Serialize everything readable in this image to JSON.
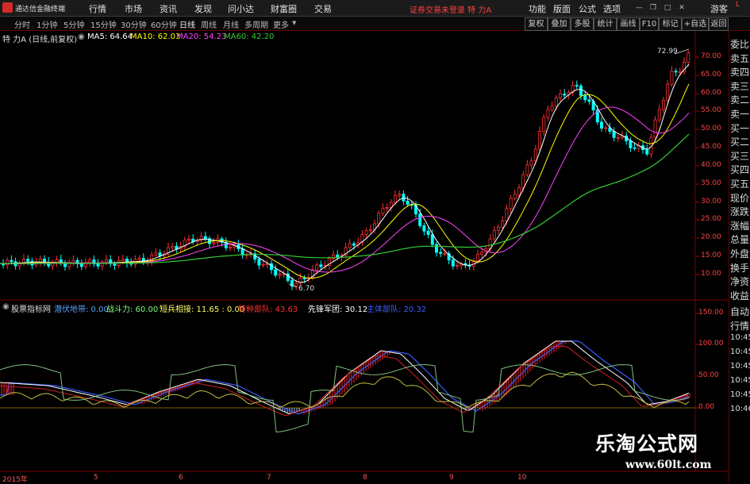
{
  "titlebar": {
    "app_name": "通达信金融终端",
    "menu": [
      "行情",
      "市场",
      "资讯",
      "发现",
      "问小达",
      "财富圈",
      "交易"
    ],
    "status": "证券交易未登录  特 力A",
    "right_menu": [
      "功能",
      "版面",
      "公式",
      "选项"
    ],
    "right_extra": "游客"
  },
  "periods": [
    "分时",
    "1分钟",
    "5分钟",
    "15分钟",
    "30分钟",
    "60分钟",
    "日线",
    "周线",
    "月线",
    "多周期",
    "更多"
  ],
  "active_period": "日线",
  "tools": [
    "复权",
    "叠加",
    "多股",
    "统计",
    "画线",
    "F10",
    "标记",
    "+自选",
    "返回"
  ],
  "main_chart": {
    "title": "特 力A (日线,前复权)",
    "ma": [
      {
        "label": "MA5: 64.64",
        "color": "#ffffff"
      },
      {
        "label": "MA10: 62.03",
        "color": "#ffff00"
      },
      {
        "label": "MA20: 54.23",
        "color": "#ff44ff"
      },
      {
        "label": "MA60: 42.20",
        "color": "#33cc33"
      }
    ],
    "high_label": "72.99",
    "low_label": "6.70",
    "y_ticks": [
      "70.00",
      "65.00",
      "60.00",
      "55.00",
      "50.00",
      "45.00",
      "40.00",
      "35.00",
      "30.00",
      "25.00",
      "20.00",
      "15.00",
      "10.00"
    ]
  },
  "indicator": {
    "name": "股票指标网",
    "items": [
      {
        "label": "潜伏地带: 0.00",
        "color": "#5aa0ff"
      },
      {
        "label": "战斗力: 60.00",
        "color": "#7fff7f"
      },
      {
        "label": "短兵相接: 11.65 : 0.00",
        "color": "#ffff66"
      },
      {
        "label": "特种部队: 43.63",
        "color": "#ff3030"
      },
      {
        "label": "先锋军团: 30.12",
        "color": "#ffffff"
      },
      {
        "label": "主体部队: 20.32",
        "color": "#3a5cff"
      }
    ],
    "y_ticks": [
      "150.00",
      "100.00",
      "50.00",
      "0.00"
    ]
  },
  "side_panel": [
    "委比",
    "卖五",
    "卖四",
    "卖三",
    "卖二",
    "卖一",
    "买一",
    "买二",
    "买三",
    "买四",
    "买五",
    "现价",
    "涨跌",
    "涨幅",
    "总量",
    "外盘",
    "换手",
    "净资",
    "收益"
  ],
  "side_panel_lower": [
    "自动",
    "行情",
    "10:45",
    "10:45",
    "10:45",
    "10:45",
    "10:45",
    "10:46"
  ],
  "x_dates": [
    "2015年",
    "5",
    "6",
    "7",
    "8",
    "9",
    "10"
  ],
  "watermark": {
    "title": "乐淘公式网",
    "url": "www.60lt.com"
  },
  "colors": {
    "up": "#ff3030",
    "down": "#00ffff",
    "axis": "#aa0000"
  }
}
